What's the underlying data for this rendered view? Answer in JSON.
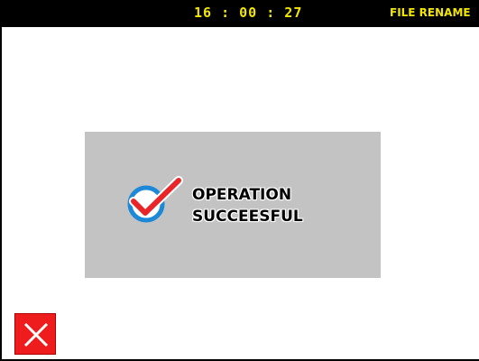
{
  "header": {
    "clock": "16 : 00 : 27",
    "screen_title": "FILE RENAME",
    "text_color": "#f2e600",
    "background": "#000000"
  },
  "dialog": {
    "message_line1": "OPERATION",
    "message_line2": "SUCCEESFUL",
    "icon": "checkmark-circle-icon",
    "background": "#c3c3c3"
  },
  "close_button": {
    "icon": "close-icon",
    "color": "#ee1c1c"
  }
}
